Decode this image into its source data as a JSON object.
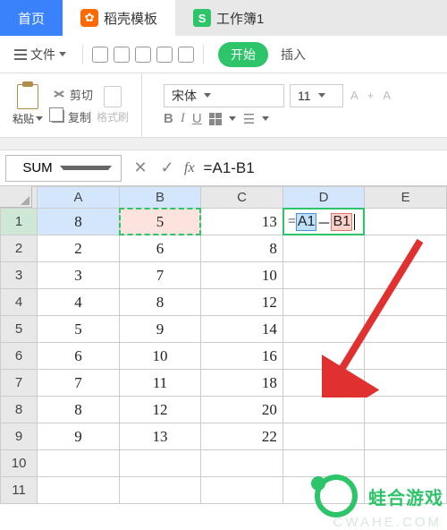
{
  "tabs": {
    "home": "首页",
    "docer": "稻壳模板",
    "book": "工作簿1"
  },
  "menubar": {
    "file": "文件",
    "start": "开始",
    "insert": "插入"
  },
  "ribbon": {
    "paste": "粘贴",
    "cut": "剪切",
    "copy": "复制",
    "brush": "格式刷",
    "font_name": "宋体",
    "font_size": "11",
    "bold": "B",
    "italic": "I",
    "underline": "U",
    "asmall": "A",
    "abig": "A"
  },
  "fx": {
    "name": "SUM",
    "formula": "=A1-B1"
  },
  "edit": {
    "eq": "=",
    "r1": "A1",
    "op": "－",
    "r2": "B1"
  },
  "columns": [
    "A",
    "B",
    "C",
    "D",
    "E"
  ],
  "rows": [
    {
      "n": "1",
      "a": "8",
      "b": "5",
      "c": "13",
      "d": "",
      "e": ""
    },
    {
      "n": "2",
      "a": "2",
      "b": "6",
      "c": "8",
      "d": "",
      "e": ""
    },
    {
      "n": "3",
      "a": "3",
      "b": "7",
      "c": "10",
      "d": "",
      "e": ""
    },
    {
      "n": "4",
      "a": "4",
      "b": "8",
      "c": "12",
      "d": "",
      "e": ""
    },
    {
      "n": "5",
      "a": "5",
      "b": "9",
      "c": "14",
      "d": "",
      "e": ""
    },
    {
      "n": "6",
      "a": "6",
      "b": "10",
      "c": "16",
      "d": "",
      "e": ""
    },
    {
      "n": "7",
      "a": "7",
      "b": "11",
      "c": "18",
      "d": "",
      "e": ""
    },
    {
      "n": "8",
      "a": "8",
      "b": "12",
      "c": "20",
      "d": "",
      "e": ""
    },
    {
      "n": "9",
      "a": "9",
      "b": "13",
      "c": "22",
      "d": "",
      "e": ""
    },
    {
      "n": "10",
      "a": "",
      "b": "",
      "c": "",
      "d": "",
      "e": ""
    },
    {
      "n": "11",
      "a": "",
      "b": "",
      "c": "",
      "d": "",
      "e": ""
    }
  ],
  "watermark": {
    "text": "蛙合游戏",
    "url": "CWAHE.COM"
  }
}
